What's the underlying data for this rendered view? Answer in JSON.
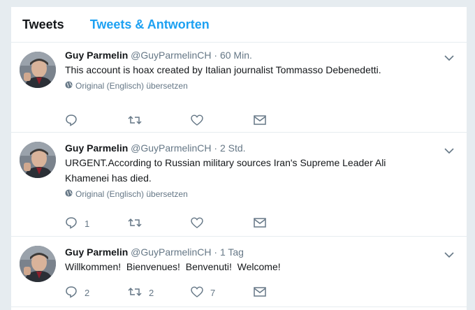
{
  "tabs": [
    {
      "label": "Tweets"
    },
    {
      "label": "Tweets & Antworten"
    }
  ],
  "tweets": [
    {
      "name": "Guy Parmelin",
      "handle": "@GuyParmelinCH",
      "separator": "·",
      "time": "60 Min.",
      "text": "This account is hoax created by Italian journalist Tommasso Debenedetti.",
      "translate": "Original (Englisch) übersetzen",
      "reply_count": "",
      "retweet_count": "",
      "like_count": ""
    },
    {
      "name": "Guy Parmelin",
      "handle": "@GuyParmelinCH",
      "separator": "·",
      "time": "2 Std.",
      "text_line1": "URGENT.According to Russian military sources Iran's Supreme Leader Ali",
      "text_line2": "Khamenei has died.",
      "translate": "Original (Englisch) übersetzen",
      "reply_count": "1",
      "retweet_count": "",
      "like_count": ""
    },
    {
      "name": "Guy Parmelin",
      "handle": "@GuyParmelinCH",
      "separator": "·",
      "time": "1 Tag",
      "text": "Willkommen!  Bienvenues!  Benvenuti!  Welcome!",
      "reply_count": "2",
      "retweet_count": "2",
      "like_count": "7"
    }
  ],
  "icons": {
    "reply": "reply-icon",
    "retweet": "retweet-icon",
    "like": "heart-icon",
    "message": "envelope-icon",
    "caret": "chevron-down-icon",
    "globe": "globe-icon"
  },
  "colors": {
    "accent": "#1da1f2",
    "muted": "#657786",
    "text": "#14171a",
    "background": "#e6ecf0"
  }
}
